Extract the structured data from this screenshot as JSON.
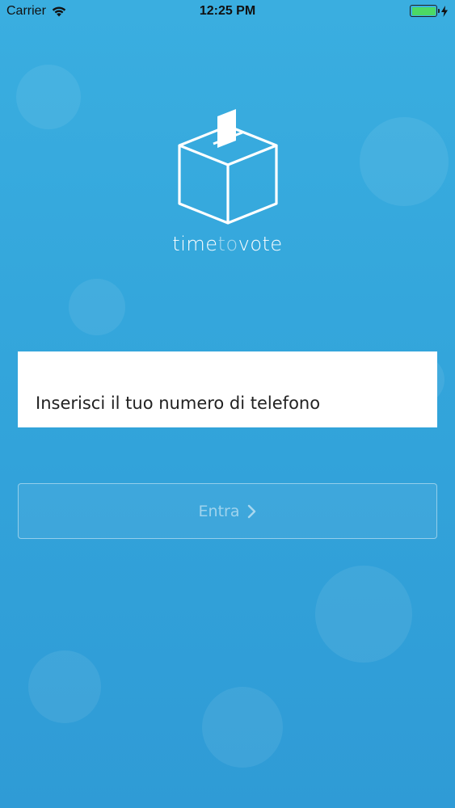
{
  "status_bar": {
    "carrier": "Carrier",
    "time": "12:25 PM",
    "battery_level": 1.0,
    "icons": [
      "wifi-icon",
      "battery-icon",
      "charging-bolt-icon"
    ]
  },
  "logo": {
    "icon": "ballot-box-icon",
    "text_part1": "time",
    "text_part2": "to",
    "text_part3": "vote"
  },
  "login": {
    "phone_placeholder": "Inserisci il tuo numero di telefono",
    "enter_label": "Entra",
    "enter_icon": "chevron-right-icon"
  },
  "colors": {
    "background": "#33a5db",
    "input_background": "#ffffff",
    "battery_fill": "#4cd964"
  }
}
